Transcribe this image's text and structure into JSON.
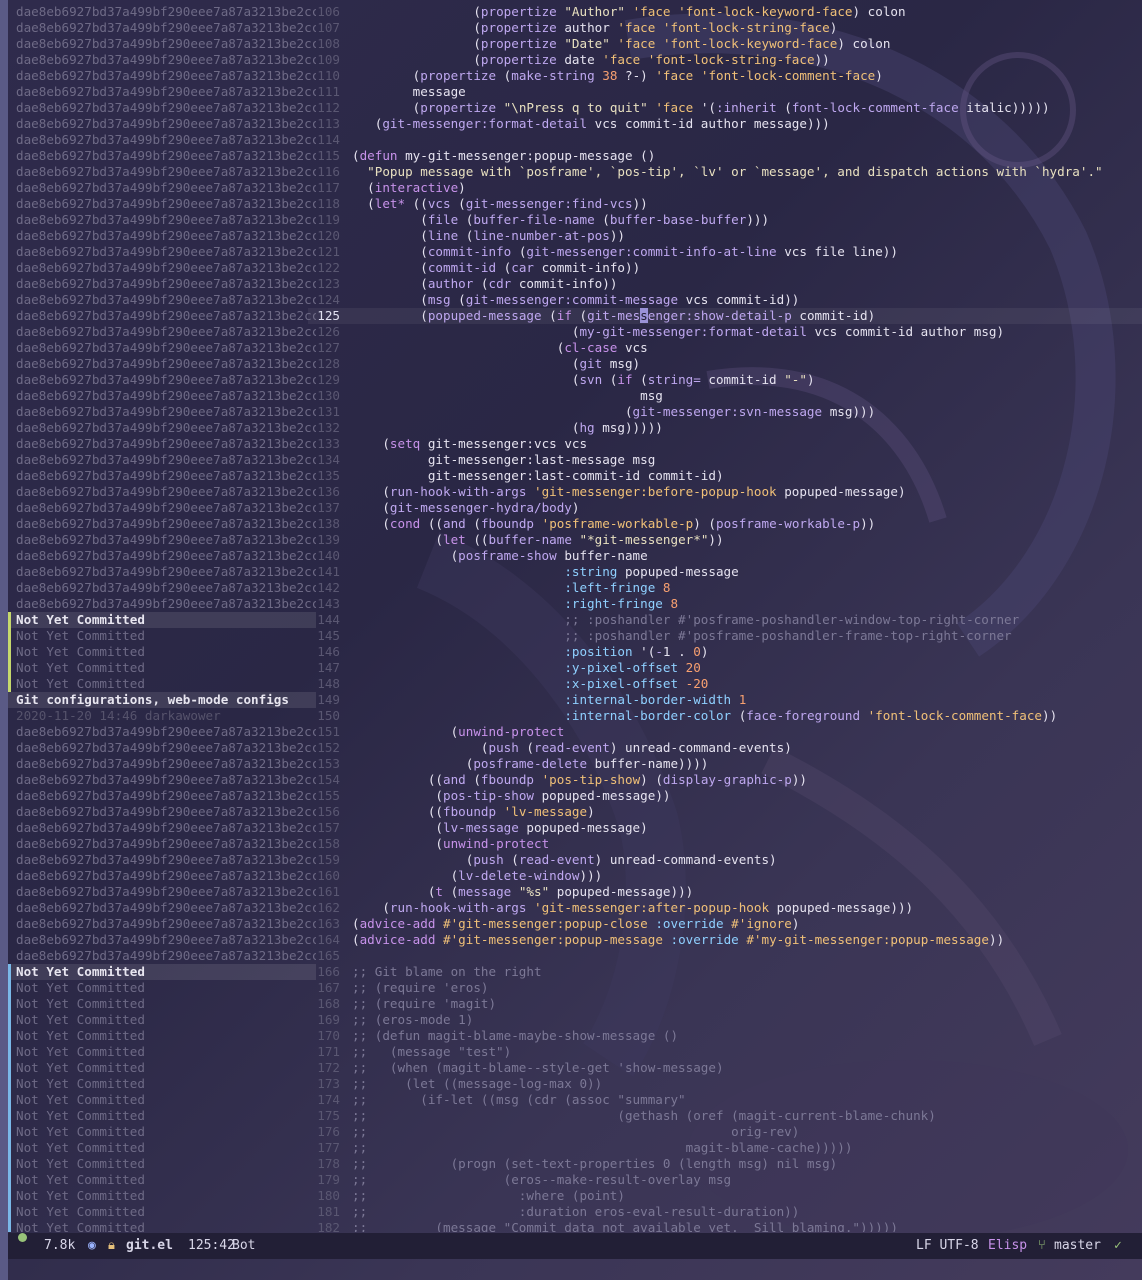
{
  "blame_hash": "dae8eb6927bd37a499bf290eee7a87a3213be2cc",
  "blame_nyc": "Not Yet Committed",
  "blame_git": "Git configurations, web-mode configs",
  "blame_date": "2020-11-20 14:46 darkawower",
  "modeline": {
    "size": "7.8k",
    "filename": "git.el",
    "position": "125:42",
    "scroll": "Bot",
    "encoding": "LF UTF-8",
    "major_mode": "Elisp",
    "branch": "master",
    "ok_mark": "✓",
    "status_color": "#98c379"
  },
  "lines": [
    {
      "n": "106",
      "code": "                (propertize \"Author\" 'face 'font-lock-keyword-face) colon"
    },
    {
      "n": "107",
      "code": "                (propertize author 'face 'font-lock-string-face)"
    },
    {
      "n": "108",
      "code": "                (propertize \"Date\" 'face 'font-lock-keyword-face) colon"
    },
    {
      "n": "109",
      "code": "                (propertize date 'face 'font-lock-string-face))"
    },
    {
      "n": "110",
      "code": "        (propertize (make-string 38 ?-) 'face 'font-lock-comment-face)"
    },
    {
      "n": "111",
      "code": "        message"
    },
    {
      "n": "112",
      "code": "        (propertize \"\\nPress q to quit\" 'face '(:inherit (font-lock-comment-face italic)))))"
    },
    {
      "n": "113",
      "code": "   (git-messenger:format-detail vcs commit-id author message)))"
    },
    {
      "n": "114",
      "code": ""
    },
    {
      "n": "115",
      "code": "(defun my-git-messenger:popup-message ()"
    },
    {
      "n": "116",
      "code": "  \"Popup message with `posframe', `pos-tip', `lv' or `message', and dispatch actions with `hydra'.\""
    },
    {
      "n": "117",
      "code": "  (interactive)"
    },
    {
      "n": "118",
      "code": "  (let* ((vcs (git-messenger:find-vcs))"
    },
    {
      "n": "119",
      "code": "         (file (buffer-file-name (buffer-base-buffer)))"
    },
    {
      "n": "120",
      "code": "         (line (line-number-at-pos))"
    },
    {
      "n": "121",
      "code": "         (commit-info (git-messenger:commit-info-at-line vcs file line))"
    },
    {
      "n": "122",
      "code": "         (commit-id (car commit-info))"
    },
    {
      "n": "123",
      "code": "         (author (cdr commit-info))"
    },
    {
      "n": "124",
      "code": "         (msg (git-messenger:commit-message vcs commit-id))"
    },
    {
      "n": "125",
      "code": "         (popuped-message (if (git-messenger:show-detail-p commit-id)"
    },
    {
      "n": "126",
      "code": "                             (my-git-messenger:format-detail vcs commit-id author msg)"
    },
    {
      "n": "127",
      "code": "                           (cl-case vcs"
    },
    {
      "n": "128",
      "code": "                             (git msg)"
    },
    {
      "n": "129",
      "code": "                             (svn (if (string= commit-id \"-\")"
    },
    {
      "n": "130",
      "code": "                                      msg"
    },
    {
      "n": "131",
      "code": "                                    (git-messenger:svn-message msg)))"
    },
    {
      "n": "132",
      "code": "                             (hg msg)))))"
    },
    {
      "n": "133",
      "code": "    (setq git-messenger:vcs vcs"
    },
    {
      "n": "134",
      "code": "          git-messenger:last-message msg"
    },
    {
      "n": "135",
      "code": "          git-messenger:last-commit-id commit-id)"
    },
    {
      "n": "136",
      "code": "    (run-hook-with-args 'git-messenger:before-popup-hook popuped-message)"
    },
    {
      "n": "137",
      "code": "    (git-messenger-hydra/body)"
    },
    {
      "n": "138",
      "code": "    (cond ((and (fboundp 'posframe-workable-p) (posframe-workable-p))"
    },
    {
      "n": "139",
      "code": "           (let ((buffer-name \"*git-messenger*\"))"
    },
    {
      "n": "140",
      "code": "             (posframe-show buffer-name"
    },
    {
      "n": "141",
      "code": "                            :string popuped-message"
    },
    {
      "n": "142",
      "code": "                            :left-fringe 8"
    },
    {
      "n": "143",
      "code": "                            :right-fringe 8"
    },
    {
      "n": "144",
      "code": "                            ;; :poshandler #'posframe-poshandler-window-top-right-corner"
    },
    {
      "n": "145",
      "code": "                            ;; :poshandler #'posframe-poshandler-frame-top-right-corner"
    },
    {
      "n": "146",
      "code": "                            :position '(-1 . 0)"
    },
    {
      "n": "147",
      "code": "                            :y-pixel-offset 20"
    },
    {
      "n": "148",
      "code": "                            :x-pixel-offset -20"
    },
    {
      "n": "149",
      "code": "                            :internal-border-width 1"
    },
    {
      "n": "150",
      "code": "                            :internal-border-color (face-foreground 'font-lock-comment-face))"
    },
    {
      "n": "151",
      "code": "             (unwind-protect"
    },
    {
      "n": "152",
      "code": "                 (push (read-event) unread-command-events)"
    },
    {
      "n": "153",
      "code": "               (posframe-delete buffer-name))))"
    },
    {
      "n": "154",
      "code": "          ((and (fboundp 'pos-tip-show) (display-graphic-p))"
    },
    {
      "n": "155",
      "code": "           (pos-tip-show popuped-message))"
    },
    {
      "n": "156",
      "code": "          ((fboundp 'lv-message)"
    },
    {
      "n": "157",
      "code": "           (lv-message popuped-message)"
    },
    {
      "n": "158",
      "code": "           (unwind-protect"
    },
    {
      "n": "159",
      "code": "               (push (read-event) unread-command-events)"
    },
    {
      "n": "160",
      "code": "             (lv-delete-window)))"
    },
    {
      "n": "161",
      "code": "          (t (message \"%s\" popuped-message)))"
    },
    {
      "n": "162",
      "code": "    (run-hook-with-args 'git-messenger:after-popup-hook popuped-message)))"
    },
    {
      "n": "163",
      "code": "(advice-add #'git-messenger:popup-close :override #'ignore)"
    },
    {
      "n": "164",
      "code": "(advice-add #'git-messenger:popup-message :override #'my-git-messenger:popup-message))"
    },
    {
      "n": "165",
      "code": ""
    },
    {
      "n": "166",
      "code": ";; Git blame on the right"
    },
    {
      "n": "167",
      "code": ";; (require 'eros)"
    },
    {
      "n": "168",
      "code": ";; (require 'magit)"
    },
    {
      "n": "169",
      "code": ";; (eros-mode 1)"
    },
    {
      "n": "170",
      "code": ";; (defun magit-blame-maybe-show-message ()"
    },
    {
      "n": "171",
      "code": ";;   (message \"test\")"
    },
    {
      "n": "172",
      "code": ";;   (when (magit-blame--style-get 'show-message)"
    },
    {
      "n": "173",
      "code": ";;     (let ((message-log-max 0))"
    },
    {
      "n": "174",
      "code": ";;       (if-let ((msg (cdr (assoc \"summary\""
    },
    {
      "n": "175",
      "code": ";;                                 (gethash (oref (magit-current-blame-chunk)"
    },
    {
      "n": "176",
      "code": ";;                                                orig-rev)"
    },
    {
      "n": "177",
      "code": ";;                                          magit-blame-cache)))))"
    },
    {
      "n": "178",
      "code": ";;           (progn (set-text-properties 0 (length msg) nil msg)"
    },
    {
      "n": "179",
      "code": ";;                  (eros--make-result-overlay msg"
    },
    {
      "n": "180",
      "code": ";;                    :where (point)"
    },
    {
      "n": "181",
      "code": ";;                    :duration eros-eval-result-duration))"
    },
    {
      "n": "182",
      "code": ";;         (message \"Commit data not available yet.  Sill blaming.\")))))"
    }
  ]
}
